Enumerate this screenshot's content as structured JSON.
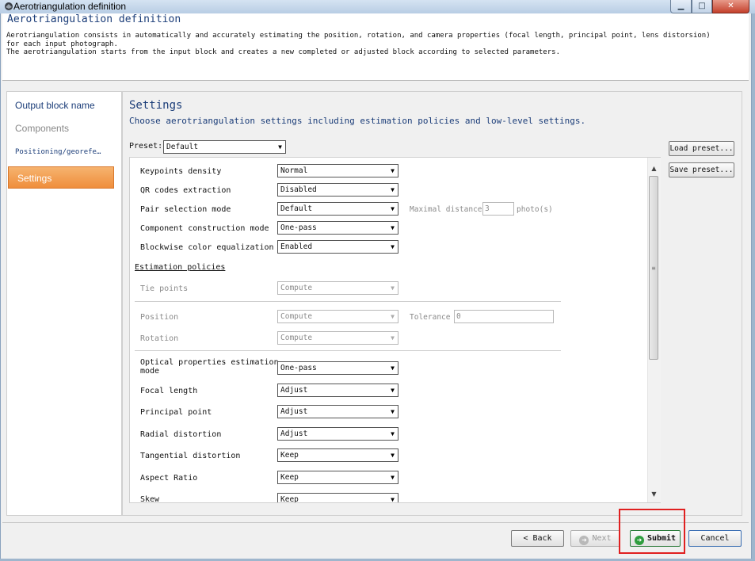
{
  "window": {
    "title": "Aerotriangulation definition",
    "controls": {
      "minimize": "▁",
      "maximize": "□",
      "close": "✕"
    }
  },
  "header": {
    "title": "Aerotriangulation definition",
    "description_line1": "Aerotriangulation consists in automatically and accurately estimating the position, rotation, and camera properties (focal length, principal point, lens distorsion)",
    "description_line2": "for each input photograph.",
    "description_line3": "The aerotriangulation starts from the input block and creates a new completed or adjusted block according to selected parameters."
  },
  "nav": {
    "items": [
      {
        "label": "Output block name",
        "state": "normal"
      },
      {
        "label": "Components",
        "state": "disabled"
      },
      {
        "label": "Positioning/georefe…",
        "state": "normal"
      },
      {
        "label": "Settings",
        "state": "active"
      }
    ]
  },
  "settings": {
    "title": "Settings",
    "subtitle": "Choose aerotriangulation settings including estimation policies and low-level settings.",
    "preset_label": "Preset:",
    "preset_value": "Default",
    "load_preset": "Load preset...",
    "save_preset": "Save preset...",
    "rows": [
      {
        "label": "Keypoints density",
        "value": "Normal"
      },
      {
        "label": "QR codes extraction",
        "value": "Disabled"
      },
      {
        "label": "Pair selection mode",
        "value": "Default"
      },
      {
        "label": "Component construction mode",
        "value": "One-pass"
      },
      {
        "label": "Blockwise color equalization",
        "value": "Enabled"
      }
    ],
    "max_distance_label": "Maximal distance",
    "max_distance_value": "3",
    "max_distance_unit": "photo(s)",
    "estimation_policies_label": "Estimation policies",
    "tie_points": {
      "label": "Tie points",
      "value": "Compute"
    },
    "position": {
      "label": "Position",
      "value": "Compute"
    },
    "tolerance_label": "Tolerance",
    "tolerance_value": "0",
    "rotation": {
      "label": "Rotation",
      "value": "Compute"
    },
    "optical_label_line1": "Optical properties estimation",
    "optical_label_line2": "mode",
    "optical_value": "One-pass",
    "optical_rows": [
      {
        "label": "Focal length",
        "value": "Adjust"
      },
      {
        "label": "Principal point",
        "value": "Adjust"
      },
      {
        "label": "Radial distortion",
        "value": "Adjust"
      },
      {
        "label": "Tangential distortion",
        "value": "Keep"
      },
      {
        "label": "Aspect Ratio",
        "value": "Keep"
      },
      {
        "label": "Skew",
        "value": "Keep"
      }
    ]
  },
  "footer": {
    "back": "< Back",
    "next": "Next",
    "submit": "Submit",
    "cancel": "Cancel"
  },
  "colors": {
    "accent_orange": "#ef8e3c",
    "title_blue": "#1a3c78",
    "highlight_red": "#e02020",
    "submit_green": "#2f9e3f"
  }
}
